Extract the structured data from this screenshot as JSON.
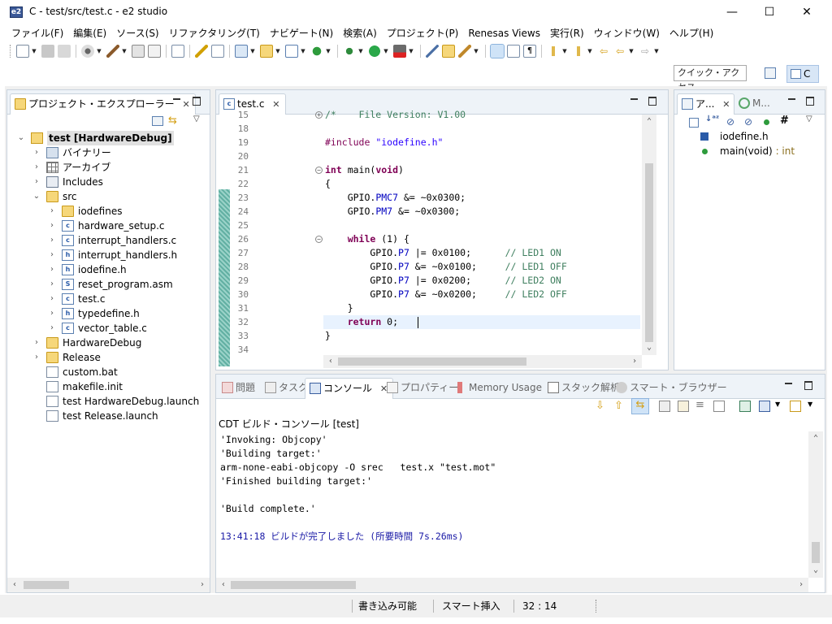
{
  "window": {
    "title": "C - test/src/test.c - e2 studio",
    "icon_text": "e2",
    "minimize": "—",
    "maximize": "☐",
    "close": "✕"
  },
  "menu": [
    "ファイル(F)",
    "編集(E)",
    "ソース(S)",
    "リファクタリング(T)",
    "ナビゲート(N)",
    "検索(A)",
    "プロジェクト(P)",
    "Renesas Views",
    "実行(R)",
    "ウィンドウ(W)",
    "ヘルプ(H)"
  ],
  "quick_access": "クイック・アクセス",
  "perspective": "C",
  "explorer": {
    "tab_label": "プロジェクト・エクスプローラー",
    "tree": [
      {
        "label": "test [HardwareDebug]",
        "icon": "project-icon",
        "arrow": "⌄",
        "level": 0,
        "selected": true
      },
      {
        "label": "バイナリー",
        "icon": "binaries-icon",
        "arrow": "›",
        "level": 1
      },
      {
        "label": "アーカイブ",
        "icon": "archives-icon",
        "arrow": "›",
        "level": 1
      },
      {
        "label": "Includes",
        "icon": "includes-icon",
        "arrow": "›",
        "level": 1
      },
      {
        "label": "src",
        "icon": "folder-icon",
        "arrow": "⌄",
        "level": 1
      },
      {
        "label": "iodefines",
        "icon": "folder-icon",
        "arrow": "›",
        "level": 2
      },
      {
        "label": "hardware_setup.c",
        "icon": "c-file-icon",
        "arrow": "›",
        "level": 2
      },
      {
        "label": "interrupt_handlers.c",
        "icon": "c-file-icon",
        "arrow": "›",
        "level": 2
      },
      {
        "label": "interrupt_handlers.h",
        "icon": "h-file-icon",
        "arrow": "›",
        "level": 2
      },
      {
        "label": "iodefine.h",
        "icon": "h-file-icon",
        "arrow": "›",
        "level": 2
      },
      {
        "label": "reset_program.asm",
        "icon": "asm-file-icon",
        "arrow": "›",
        "level": 2
      },
      {
        "label": "test.c",
        "icon": "c-file-icon",
        "arrow": "›",
        "level": 2
      },
      {
        "label": "typedefine.h",
        "icon": "h-file-icon",
        "arrow": "›",
        "level": 2
      },
      {
        "label": "vector_table.c",
        "icon": "c-file-icon",
        "arrow": "›",
        "level": 2
      },
      {
        "label": "HardwareDebug",
        "icon": "folder-icon",
        "arrow": "›",
        "level": 1
      },
      {
        "label": "Release",
        "icon": "folder-icon",
        "arrow": "›",
        "level": 1
      },
      {
        "label": "custom.bat",
        "icon": "file-icon",
        "arrow": "",
        "level": 1
      },
      {
        "label": "makefile.init",
        "icon": "file-icon",
        "arrow": "",
        "level": 1
      },
      {
        "label": "test HardwareDebug.launch",
        "icon": "file-icon",
        "arrow": "",
        "level": 1
      },
      {
        "label": "test Release.launch",
        "icon": "file-icon",
        "arrow": "",
        "level": 1
      }
    ]
  },
  "editor": {
    "tab_label": "test.c",
    "lines": [
      {
        "n": "15",
        "html": "<span class=\"cm\">/*    File Version: V1.00</span>"
      },
      {
        "n": "18",
        "html": ""
      },
      {
        "n": "19",
        "html": "<span class=\"pp\">#include</span> <span class=\"st\">\"iodefine.h\"</span>"
      },
      {
        "n": "20",
        "html": ""
      },
      {
        "n": "21",
        "html": "<span class=\"kw\">int</span> main(<span class=\"kw\">void</span>)"
      },
      {
        "n": "22",
        "html": "{"
      },
      {
        "n": "23",
        "html": "    GPIO.<span class=\"fld\">PMC7</span> &amp;= ~0x0300;"
      },
      {
        "n": "24",
        "html": "    GPIO.<span class=\"fld\">PM7</span> &amp;= ~0x0300;"
      },
      {
        "n": "25",
        "html": ""
      },
      {
        "n": "26",
        "html": "    <span class=\"kw\">while</span> (1) {"
      },
      {
        "n": "27",
        "html": "        GPIO.<span class=\"fld\">P7</span> |= 0x0100;      <span class=\"cm\">// LED1 ON</span>"
      },
      {
        "n": "28",
        "html": "        GPIO.<span class=\"fld\">P7</span> &amp;= ~0x0100;     <span class=\"cm\">// LED1 OFF</span>"
      },
      {
        "n": "29",
        "html": "        GPIO.<span class=\"fld\">P7</span> |= 0x0200;      <span class=\"cm\">// LED2 ON</span>"
      },
      {
        "n": "30",
        "html": "        GPIO.<span class=\"fld\">P7</span> &amp;= ~0x0200;     <span class=\"cm\">// LED2 OFF</span>"
      },
      {
        "n": "31",
        "html": "    }"
      },
      {
        "n": "32",
        "html": "    <span class=\"kw\">return</span> 0;"
      },
      {
        "n": "33",
        "html": "}"
      },
      {
        "n": "34",
        "html": ""
      }
    ]
  },
  "outline": {
    "tab_label": "ア...",
    "tab2_label": "M...",
    "items": [
      {
        "label": "iodefine.h",
        "type": ""
      },
      {
        "label": "main(void)",
        "type": " : int"
      }
    ]
  },
  "console": {
    "tabs": [
      "問題",
      "タスク",
      "コンソール",
      "プロパティー",
      "Memory Usage",
      "スタック解析",
      "スマート・ブラウザー"
    ],
    "title": "CDT ビルド・コンソール [test]",
    "lines": [
      {
        "text": "'Invoking: Objcopy'",
        "style": ""
      },
      {
        "text": "'Building target:'",
        "style": ""
      },
      {
        "text": "arm-none-eabi-objcopy -O srec   test.x \"test.mot\"",
        "style": ""
      },
      {
        "text": "'Finished building target:'",
        "style": ""
      },
      {
        "text": "",
        "style": ""
      },
      {
        "text": "'Build complete.'",
        "style": ""
      },
      {
        "text": "",
        "style": ""
      },
      {
        "text": "13:41:18 ビルドが完了しました (所要時間 7s.26ms)",
        "style": "blue"
      }
    ]
  },
  "status": {
    "writable": "書き込み可能",
    "insert_mode": "スマート挿入",
    "position": "32 : 14"
  },
  "colors": {
    "accent": "#3b5998",
    "tab_border": "#c9d3dd",
    "change_ruler": "#7cc2b6",
    "keyword": "#7f0055",
    "comment": "#3f7f5f",
    "string": "#2a00ff",
    "field": "#0000c0"
  }
}
